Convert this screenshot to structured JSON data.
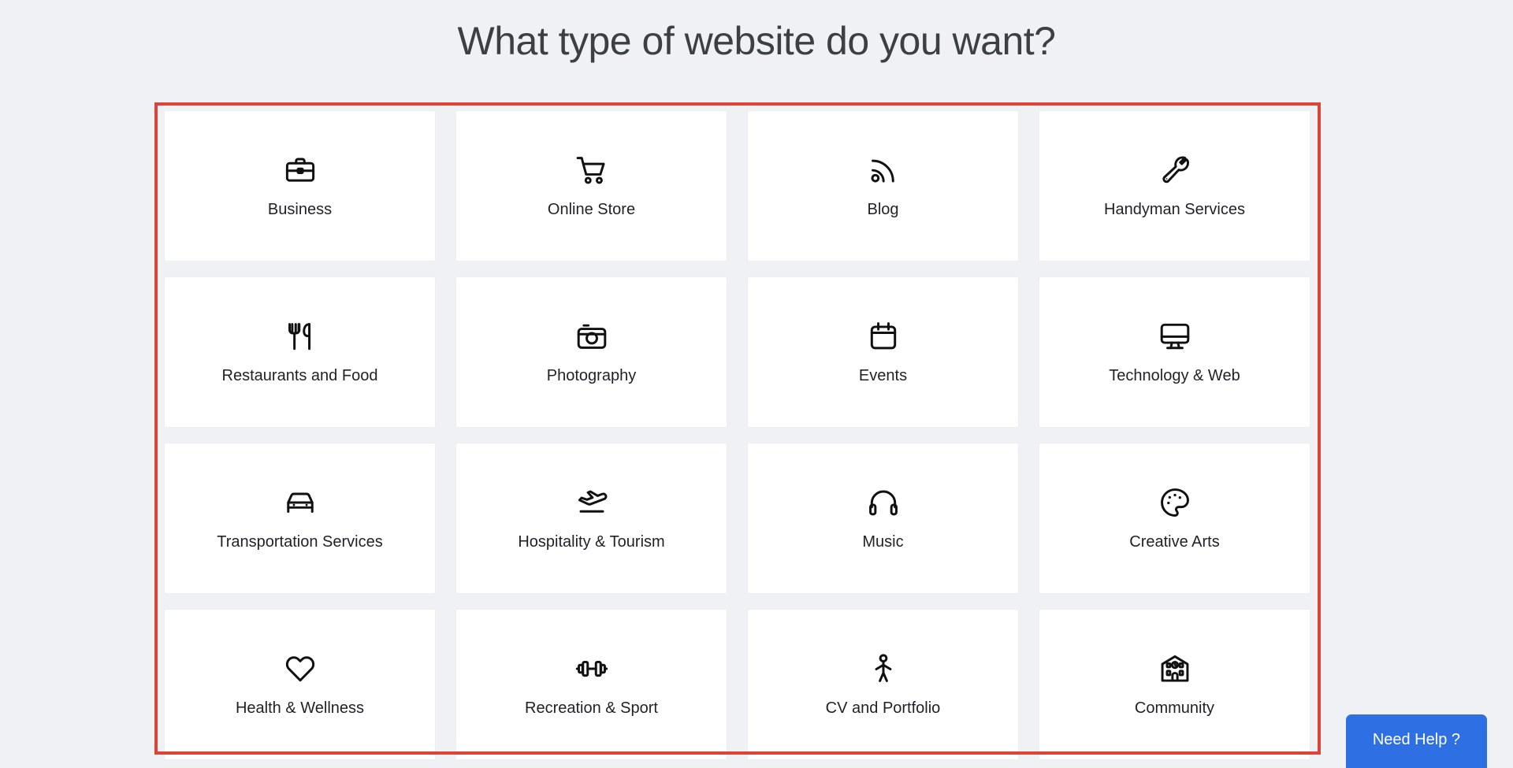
{
  "page": {
    "title": "What type of website do you want?",
    "background_color": "#eff1f5",
    "title_color": "#3c4043"
  },
  "selection": {
    "border_color": "#db4437",
    "active": true
  },
  "grid": {
    "columns": 4,
    "rows": 4,
    "cards": [
      {
        "label": "Business",
        "icon": "briefcase-icon"
      },
      {
        "label": "Online Store",
        "icon": "shopping-cart-icon"
      },
      {
        "label": "Blog",
        "icon": "rss-feed-icon"
      },
      {
        "label": "Handyman Services",
        "icon": "wrench-icon"
      },
      {
        "label": "Restaurants and Food",
        "icon": "fork-knife-icon"
      },
      {
        "label": "Photography",
        "icon": "camera-icon"
      },
      {
        "label": "Events",
        "icon": "calendar-icon"
      },
      {
        "label": "Technology & Web",
        "icon": "desktop-monitor-icon"
      },
      {
        "label": "Transportation Services",
        "icon": "car-icon"
      },
      {
        "label": "Hospitality & Tourism",
        "icon": "airplane-takeoff-icon"
      },
      {
        "label": "Music",
        "icon": "headphones-icon"
      },
      {
        "label": "Creative Arts",
        "icon": "paint-palette-icon"
      },
      {
        "label": "Health & Wellness",
        "icon": "heart-icon"
      },
      {
        "label": "Recreation & Sport",
        "icon": "dumbbell-icon"
      },
      {
        "label": "CV and Portfolio",
        "icon": "person-standing-icon"
      },
      {
        "label": "Community",
        "icon": "civic-building-icon"
      }
    ]
  },
  "help_widget": {
    "label": "Need Help ?",
    "background_color": "#2f6fe4",
    "text_color": "#ffffff"
  }
}
